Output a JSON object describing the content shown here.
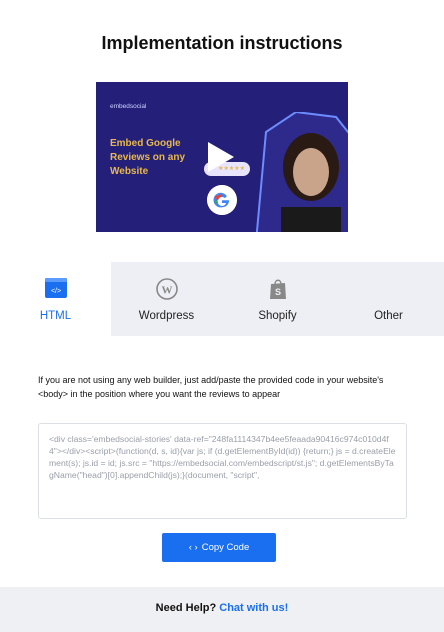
{
  "page": {
    "title": "Implementation instructions"
  },
  "video": {
    "brand": "embedsocial",
    "caption": "Embed Google Reviews on any Website",
    "stars": "★★★★★"
  },
  "tabs": [
    {
      "label": "HTML",
      "icon": "code-icon",
      "active": true
    },
    {
      "label": "Wordpress",
      "icon": "wordpress-icon",
      "active": false
    },
    {
      "label": "Shopify",
      "icon": "shopify-icon",
      "active": false
    },
    {
      "label": "Other",
      "icon": "",
      "active": false
    }
  ],
  "instruction": "If you are not using any web builder, just add/paste the provided code in your website's <body> in the position where you want the reviews to appear",
  "code": "<div class='embedsocial-stories' data-ref=\"248fa1114347b4ee5feaada90416c974c010d4f4\"></div><script>(function(d, s, id){var js; if (d.getElementById(id)) {return;} js = d.createElement(s); js.id = id; js.src = \"https://embedsocial.com/embedscript/st.js\"; d.getElementsByTagName(\"head\")[0].appendChild(js);}(document, \"script\",",
  "copy_button": {
    "icon": "‹ ›",
    "label": "Copy Code"
  },
  "help": {
    "text": "Need Help?",
    "link": "Chat with us!"
  },
  "colors": {
    "accent": "#1a6ff1",
    "video_bg": "#24207a",
    "tab_inactive_bg": "#edeff4"
  }
}
